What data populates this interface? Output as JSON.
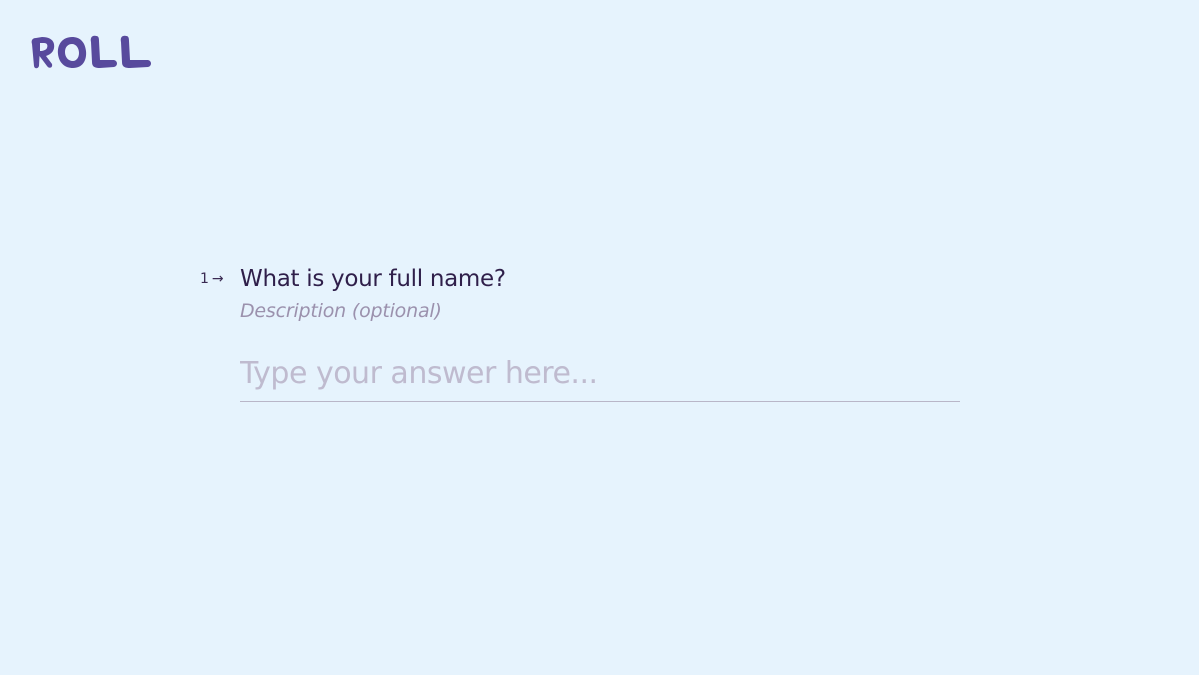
{
  "brand": {
    "logo_text": "ROLL",
    "logo_color": "#584a9d"
  },
  "question": {
    "number": "1",
    "arrow_icon": "arrow-right-icon",
    "title": "What is your full name?",
    "description": "Description (optional)",
    "answer_placeholder": "Type your answer here...",
    "answer_value": ""
  },
  "colors": {
    "background": "#e6f3fd",
    "title": "#2f1f4a",
    "description": "#9b91ad",
    "placeholder": "#bfbbcf",
    "underline": "#b9b6c8"
  }
}
